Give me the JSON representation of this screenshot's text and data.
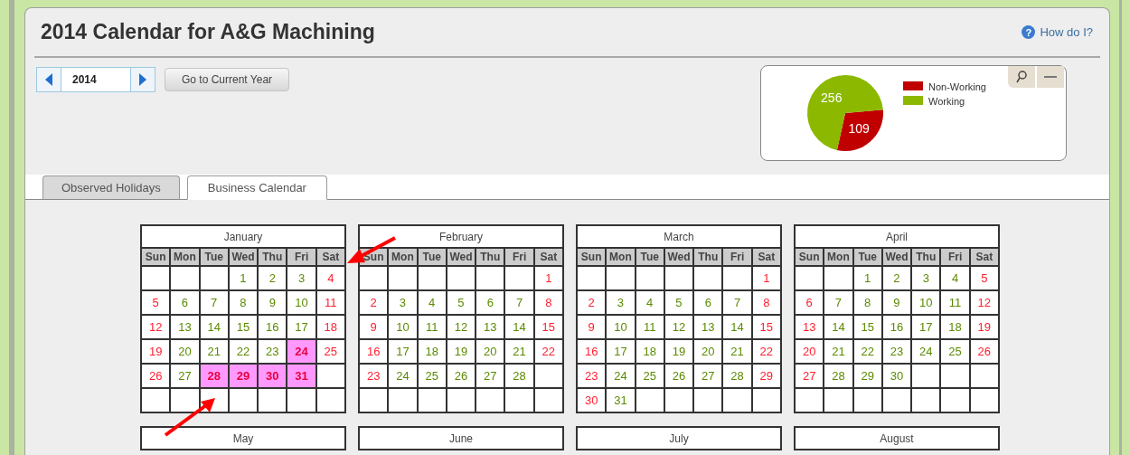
{
  "page": {
    "title": "2014 Calendar for A&G Machining",
    "help_icon": "?",
    "help_link": "How do I?"
  },
  "year_nav": {
    "year": "2014",
    "current_button": "Go to Current Year"
  },
  "summary": {
    "chart_data": {
      "type": "pie",
      "categories": [
        "Non-Working",
        "Working"
      ],
      "values": [
        109,
        256
      ],
      "data_labels": true,
      "legend": true
    }
  },
  "tabs": [
    {
      "label": "Observed Holidays",
      "selected": false
    },
    {
      "label": "Business Calendar",
      "selected": true
    }
  ],
  "months": [
    {
      "name": "January",
      "weekdays": [
        "Sun",
        "Mon",
        "Tue",
        "Wed",
        "Thu",
        "Fri",
        "Sat"
      ],
      "weeks": [
        [
          {
            "kind": "blank"
          },
          {
            "kind": "blank"
          },
          {
            "kind": "blank"
          },
          {
            "day": "1",
            "kind": "working"
          },
          {
            "day": "2",
            "kind": "working"
          },
          {
            "day": "3",
            "kind": "working"
          },
          {
            "day": "4",
            "kind": "off"
          }
        ],
        [
          {
            "day": "5",
            "kind": "off"
          },
          {
            "day": "6",
            "kind": "working"
          },
          {
            "day": "7",
            "kind": "working"
          },
          {
            "day": "8",
            "kind": "working"
          },
          {
            "day": "9",
            "kind": "working"
          },
          {
            "day": "10",
            "kind": "working"
          },
          {
            "day": "11",
            "kind": "off"
          }
        ],
        [
          {
            "day": "12",
            "kind": "off"
          },
          {
            "day": "13",
            "kind": "working"
          },
          {
            "day": "14",
            "kind": "working"
          },
          {
            "day": "15",
            "kind": "working"
          },
          {
            "day": "16",
            "kind": "working"
          },
          {
            "day": "17",
            "kind": "working"
          },
          {
            "day": "18",
            "kind": "off"
          }
        ],
        [
          {
            "day": "19",
            "kind": "off"
          },
          {
            "day": "20",
            "kind": "working"
          },
          {
            "day": "21",
            "kind": "working"
          },
          {
            "day": "22",
            "kind": "working"
          },
          {
            "day": "23",
            "kind": "working"
          },
          {
            "day": "24",
            "kind": "marked"
          },
          {
            "day": "25",
            "kind": "off"
          }
        ],
        [
          {
            "day": "26",
            "kind": "off"
          },
          {
            "day": "27",
            "kind": "working"
          },
          {
            "day": "28",
            "kind": "marked"
          },
          {
            "day": "29",
            "kind": "marked"
          },
          {
            "day": "30",
            "kind": "marked"
          },
          {
            "day": "31",
            "kind": "marked"
          },
          {
            "kind": "blank"
          }
        ],
        [
          {
            "kind": "blank"
          },
          {
            "kind": "blank"
          },
          {
            "kind": "blank"
          },
          {
            "kind": "blank"
          },
          {
            "kind": "blank"
          },
          {
            "kind": "blank"
          },
          {
            "kind": "blank"
          }
        ]
      ]
    },
    {
      "name": "February",
      "weekdays": [
        "Sun",
        "Mon",
        "Tue",
        "Wed",
        "Thu",
        "Fri",
        "Sat"
      ],
      "weeks": [
        [
          {
            "kind": "blank"
          },
          {
            "kind": "blank"
          },
          {
            "kind": "blank"
          },
          {
            "kind": "blank"
          },
          {
            "kind": "blank"
          },
          {
            "kind": "blank"
          },
          {
            "day": "1",
            "kind": "off"
          }
        ],
        [
          {
            "day": "2",
            "kind": "off"
          },
          {
            "day": "3",
            "kind": "working"
          },
          {
            "day": "4",
            "kind": "working"
          },
          {
            "day": "5",
            "kind": "working"
          },
          {
            "day": "6",
            "kind": "working"
          },
          {
            "day": "7",
            "kind": "working"
          },
          {
            "day": "8",
            "kind": "off"
          }
        ],
        [
          {
            "day": "9",
            "kind": "off"
          },
          {
            "day": "10",
            "kind": "working"
          },
          {
            "day": "11",
            "kind": "working"
          },
          {
            "day": "12",
            "kind": "working"
          },
          {
            "day": "13",
            "kind": "working"
          },
          {
            "day": "14",
            "kind": "working"
          },
          {
            "day": "15",
            "kind": "off"
          }
        ],
        [
          {
            "day": "16",
            "kind": "off"
          },
          {
            "day": "17",
            "kind": "working"
          },
          {
            "day": "18",
            "kind": "working"
          },
          {
            "day": "19",
            "kind": "working"
          },
          {
            "day": "20",
            "kind": "working"
          },
          {
            "day": "21",
            "kind": "working"
          },
          {
            "day": "22",
            "kind": "off"
          }
        ],
        [
          {
            "day": "23",
            "kind": "off"
          },
          {
            "day": "24",
            "kind": "working"
          },
          {
            "day": "25",
            "kind": "working"
          },
          {
            "day": "26",
            "kind": "working"
          },
          {
            "day": "27",
            "kind": "working"
          },
          {
            "day": "28",
            "kind": "working"
          },
          {
            "kind": "blank"
          }
        ],
        [
          {
            "kind": "blank"
          },
          {
            "kind": "blank"
          },
          {
            "kind": "blank"
          },
          {
            "kind": "blank"
          },
          {
            "kind": "blank"
          },
          {
            "kind": "blank"
          },
          {
            "kind": "blank"
          }
        ]
      ]
    },
    {
      "name": "March",
      "weekdays": [
        "Sun",
        "Mon",
        "Tue",
        "Wed",
        "Thu",
        "Fri",
        "Sat"
      ],
      "weeks": [
        [
          {
            "kind": "blank"
          },
          {
            "kind": "blank"
          },
          {
            "kind": "blank"
          },
          {
            "kind": "blank"
          },
          {
            "kind": "blank"
          },
          {
            "kind": "blank"
          },
          {
            "day": "1",
            "kind": "off"
          }
        ],
        [
          {
            "day": "2",
            "kind": "off"
          },
          {
            "day": "3",
            "kind": "working"
          },
          {
            "day": "4",
            "kind": "working"
          },
          {
            "day": "5",
            "kind": "working"
          },
          {
            "day": "6",
            "kind": "working"
          },
          {
            "day": "7",
            "kind": "working"
          },
          {
            "day": "8",
            "kind": "off"
          }
        ],
        [
          {
            "day": "9",
            "kind": "off"
          },
          {
            "day": "10",
            "kind": "working"
          },
          {
            "day": "11",
            "kind": "working"
          },
          {
            "day": "12",
            "kind": "working"
          },
          {
            "day": "13",
            "kind": "working"
          },
          {
            "day": "14",
            "kind": "working"
          },
          {
            "day": "15",
            "kind": "off"
          }
        ],
        [
          {
            "day": "16",
            "kind": "off"
          },
          {
            "day": "17",
            "kind": "working"
          },
          {
            "day": "18",
            "kind": "working"
          },
          {
            "day": "19",
            "kind": "working"
          },
          {
            "day": "20",
            "kind": "working"
          },
          {
            "day": "21",
            "kind": "working"
          },
          {
            "day": "22",
            "kind": "off"
          }
        ],
        [
          {
            "day": "23",
            "kind": "off"
          },
          {
            "day": "24",
            "kind": "working"
          },
          {
            "day": "25",
            "kind": "working"
          },
          {
            "day": "26",
            "kind": "working"
          },
          {
            "day": "27",
            "kind": "working"
          },
          {
            "day": "28",
            "kind": "working"
          },
          {
            "day": "29",
            "kind": "off"
          }
        ],
        [
          {
            "day": "30",
            "kind": "off"
          },
          {
            "day": "31",
            "kind": "working"
          },
          {
            "kind": "blank"
          },
          {
            "kind": "blank"
          },
          {
            "kind": "blank"
          },
          {
            "kind": "blank"
          },
          {
            "kind": "blank"
          }
        ]
      ]
    },
    {
      "name": "April",
      "weekdays": [
        "Sun",
        "Mon",
        "Tue",
        "Wed",
        "Thu",
        "Fri",
        "Sat"
      ],
      "weeks": [
        [
          {
            "kind": "blank"
          },
          {
            "kind": "blank"
          },
          {
            "day": "1",
            "kind": "working"
          },
          {
            "day": "2",
            "kind": "working"
          },
          {
            "day": "3",
            "kind": "working"
          },
          {
            "day": "4",
            "kind": "working"
          },
          {
            "day": "5",
            "kind": "off"
          }
        ],
        [
          {
            "day": "6",
            "kind": "off"
          },
          {
            "day": "7",
            "kind": "working"
          },
          {
            "day": "8",
            "kind": "working"
          },
          {
            "day": "9",
            "kind": "working"
          },
          {
            "day": "10",
            "kind": "working"
          },
          {
            "day": "11",
            "kind": "working"
          },
          {
            "day": "12",
            "kind": "off"
          }
        ],
        [
          {
            "day": "13",
            "kind": "off"
          },
          {
            "day": "14",
            "kind": "working"
          },
          {
            "day": "15",
            "kind": "working"
          },
          {
            "day": "16",
            "kind": "working"
          },
          {
            "day": "17",
            "kind": "working"
          },
          {
            "day": "18",
            "kind": "working"
          },
          {
            "day": "19",
            "kind": "off"
          }
        ],
        [
          {
            "day": "20",
            "kind": "off"
          },
          {
            "day": "21",
            "kind": "working"
          },
          {
            "day": "22",
            "kind": "working"
          },
          {
            "day": "23",
            "kind": "working"
          },
          {
            "day": "24",
            "kind": "working"
          },
          {
            "day": "25",
            "kind": "working"
          },
          {
            "day": "26",
            "kind": "off"
          }
        ],
        [
          {
            "day": "27",
            "kind": "off"
          },
          {
            "day": "28",
            "kind": "working"
          },
          {
            "day": "29",
            "kind": "working"
          },
          {
            "day": "30",
            "kind": "working"
          },
          {
            "kind": "blank"
          },
          {
            "kind": "blank"
          },
          {
            "kind": "blank"
          }
        ],
        [
          {
            "kind": "blank"
          },
          {
            "kind": "blank"
          },
          {
            "kind": "blank"
          },
          {
            "kind": "blank"
          },
          {
            "kind": "blank"
          },
          {
            "kind": "blank"
          },
          {
            "kind": "blank"
          }
        ]
      ]
    },
    {
      "name": "May"
    },
    {
      "name": "June"
    },
    {
      "name": "July"
    },
    {
      "name": "August"
    }
  ]
}
